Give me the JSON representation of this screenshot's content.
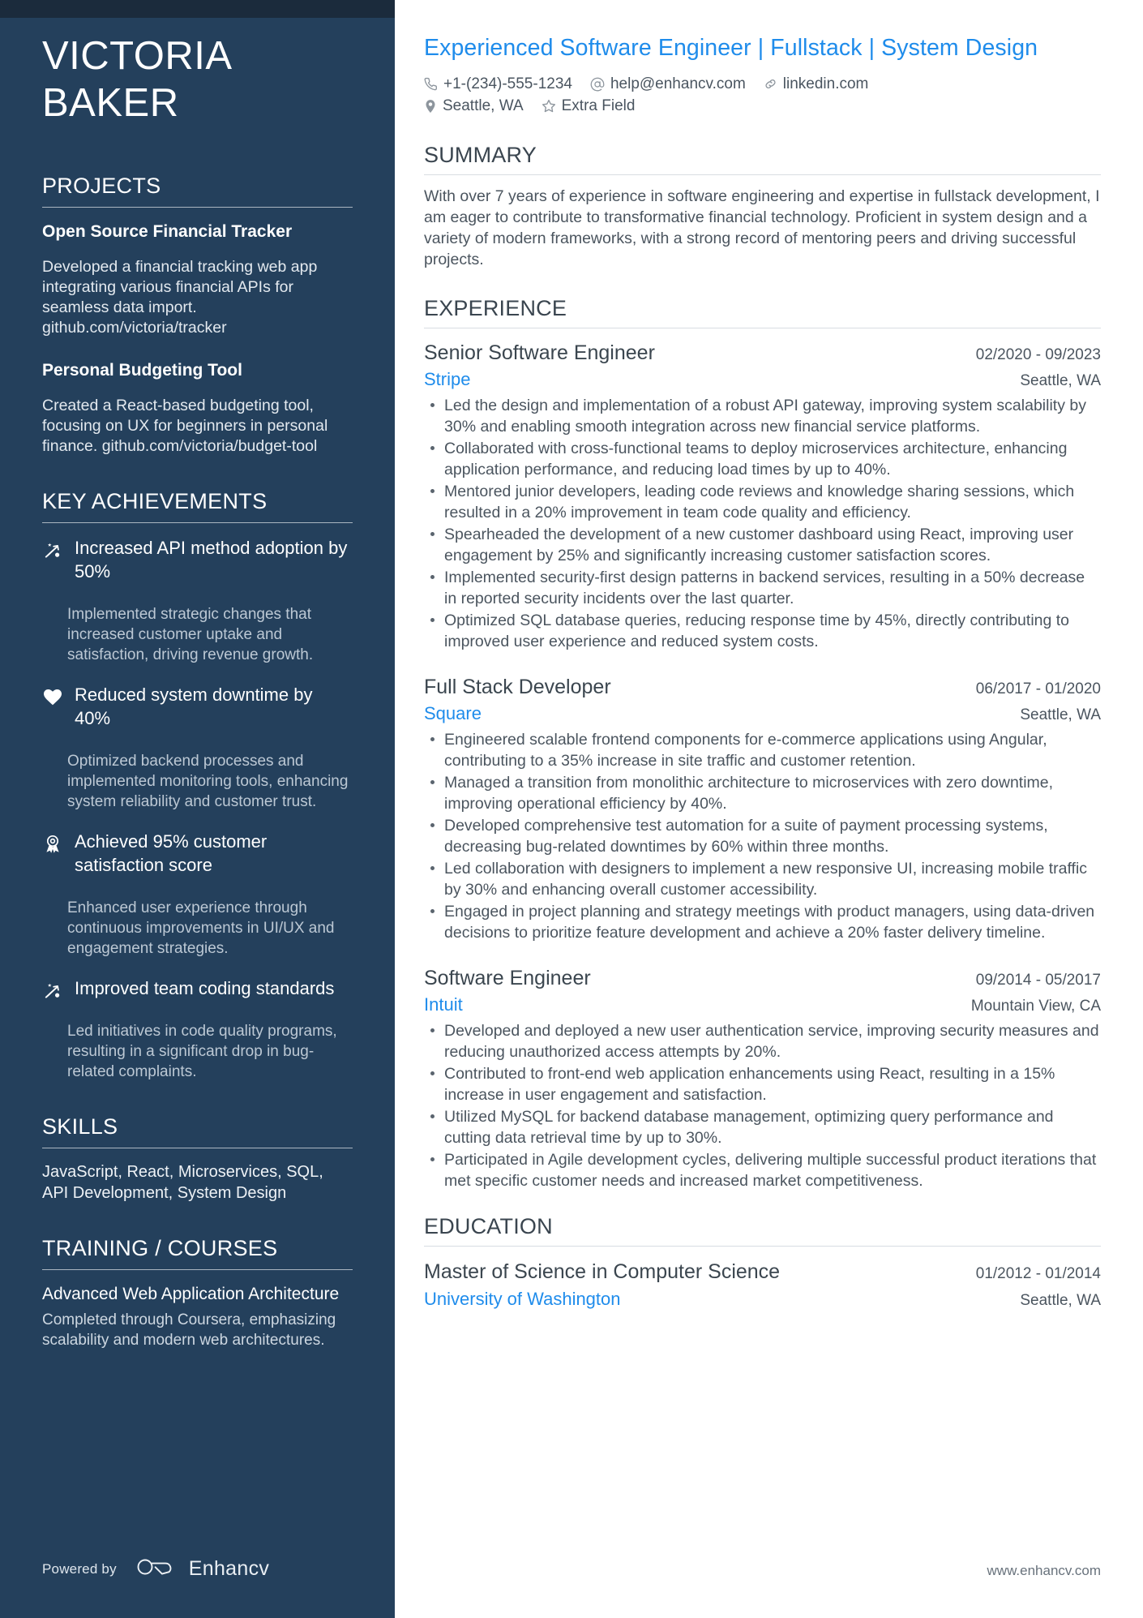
{
  "sidebar": {
    "name_lines": [
      "VICTORIA",
      "BAKER"
    ],
    "projects": {
      "heading": "PROJECTS",
      "items": [
        {
          "title": "Open Source Financial Tracker",
          "description": "Developed a financial tracking web app integrating various financial APIs for seamless data import. github.com/victoria/tracker"
        },
        {
          "title": "Personal Budgeting Tool",
          "description": "Created a React-based budgeting tool, focusing on UX for beginners in personal finance. github.com/victoria/budget-tool"
        }
      ]
    },
    "achievements": {
      "heading": "KEY ACHIEVEMENTS",
      "items": [
        {
          "icon": "strategy-arrow-icon",
          "title": "Increased API method adoption by 50%",
          "description": "Implemented strategic changes that increased customer uptake and satisfaction, driving revenue growth."
        },
        {
          "icon": "heart-icon",
          "title": "Reduced system downtime by 40%",
          "description": "Optimized backend processes and implemented monitoring tools, enhancing system reliability and customer trust."
        },
        {
          "icon": "award-ribbon-icon",
          "title": "Achieved 95% customer satisfaction score",
          "description": "Enhanced user experience through continuous improvements in UI/UX and engagement strategies."
        },
        {
          "icon": "strategy-arrow-icon",
          "title": "Improved team coding standards",
          "description": "Led initiatives in code quality programs, resulting in a significant drop in bug-related complaints."
        }
      ]
    },
    "skills": {
      "heading": "SKILLS",
      "text": "JavaScript, React, Microservices, SQL, API Development, System Design"
    },
    "training": {
      "heading": "TRAINING / COURSES",
      "items": [
        {
          "title": "Advanced Web Application Architecture",
          "description": "Completed through Coursera, emphasizing scalability and modern web architectures."
        }
      ]
    },
    "footer": {
      "powered_by": "Powered by",
      "brand": "Enhancv"
    }
  },
  "main": {
    "headline": "Experienced Software Engineer | Fullstack | System Design",
    "contact": [
      {
        "icon": "phone-icon",
        "text": "+1-(234)-555-1234"
      },
      {
        "icon": "at-icon",
        "text": "help@enhancv.com"
      },
      {
        "icon": "link-icon",
        "text": "linkedin.com"
      },
      {
        "icon": "location-icon",
        "text": "Seattle, WA"
      },
      {
        "icon": "star-icon",
        "text": "Extra Field"
      }
    ],
    "summary": {
      "heading": "SUMMARY",
      "text": "With over 7 years of experience in software engineering and expertise in fullstack development, I am eager to contribute to transformative financial technology. Proficient in system design and a variety of modern frameworks, with a strong record of mentoring peers and driving successful projects."
    },
    "experience": {
      "heading": "EXPERIENCE",
      "jobs": [
        {
          "title": "Senior Software Engineer",
          "dates": "02/2020 - 09/2023",
          "company": "Stripe",
          "location": "Seattle, WA",
          "bullets": [
            "Led the design and implementation of a robust API gateway, improving system scalability by 30% and enabling smooth integration across new financial service platforms.",
            "Collaborated with cross-functional teams to deploy microservices architecture, enhancing application performance, and reducing load times by up to 40%.",
            "Mentored junior developers, leading code reviews and knowledge sharing sessions, which resulted in a 20% improvement in team code quality and efficiency.",
            "Spearheaded the development of a new customer dashboard using React, improving user engagement by 25% and significantly increasing customer satisfaction scores.",
            "Implemented security-first design patterns in backend services, resulting in a 50% decrease in reported security incidents over the last quarter.",
            "Optimized SQL database queries, reducing response time by 45%, directly contributing to improved user experience and reduced system costs."
          ]
        },
        {
          "title": "Full Stack Developer",
          "dates": "06/2017 - 01/2020",
          "company": "Square",
          "location": "Seattle, WA",
          "bullets": [
            "Engineered scalable frontend components for e-commerce applications using Angular, contributing to a 35% increase in site traffic and customer retention.",
            "Managed a transition from monolithic architecture to microservices with zero downtime, improving operational efficiency by 40%.",
            "Developed comprehensive test automation for a suite of payment processing systems, decreasing bug-related downtimes by 60% within three months.",
            "Led collaboration with designers to implement a new responsive UI, increasing mobile traffic by 30% and enhancing overall customer accessibility.",
            "Engaged in project planning and strategy meetings with product managers, using data-driven decisions to prioritize feature development and achieve a 20% faster delivery timeline."
          ]
        },
        {
          "title": "Software Engineer",
          "dates": "09/2014 - 05/2017",
          "company": "Intuit",
          "location": "Mountain View, CA",
          "bullets": [
            "Developed and deployed a new user authentication service, improving security measures and reducing unauthorized access attempts by 20%.",
            "Contributed to front-end web application enhancements using React, resulting in a 15% increase in user engagement and satisfaction.",
            "Utilized MySQL for backend database management, optimizing query performance and cutting data retrieval time by up to 30%.",
            "Participated in Agile development cycles, delivering multiple successful product iterations that met specific customer needs and increased market competitiveness."
          ]
        }
      ]
    },
    "education": {
      "heading": "EDUCATION",
      "items": [
        {
          "degree": "Master of Science in Computer Science",
          "dates": "01/2012 - 01/2014",
          "school": "University of Washington",
          "location": "Seattle, WA"
        }
      ]
    },
    "footer_url": "www.enhancv.com"
  },
  "colors": {
    "sidebar_bg": "#24405c",
    "sidebar_topbar": "#1b2b3c",
    "accent_blue": "#1f8ceb",
    "body_text": "#4b555f"
  }
}
